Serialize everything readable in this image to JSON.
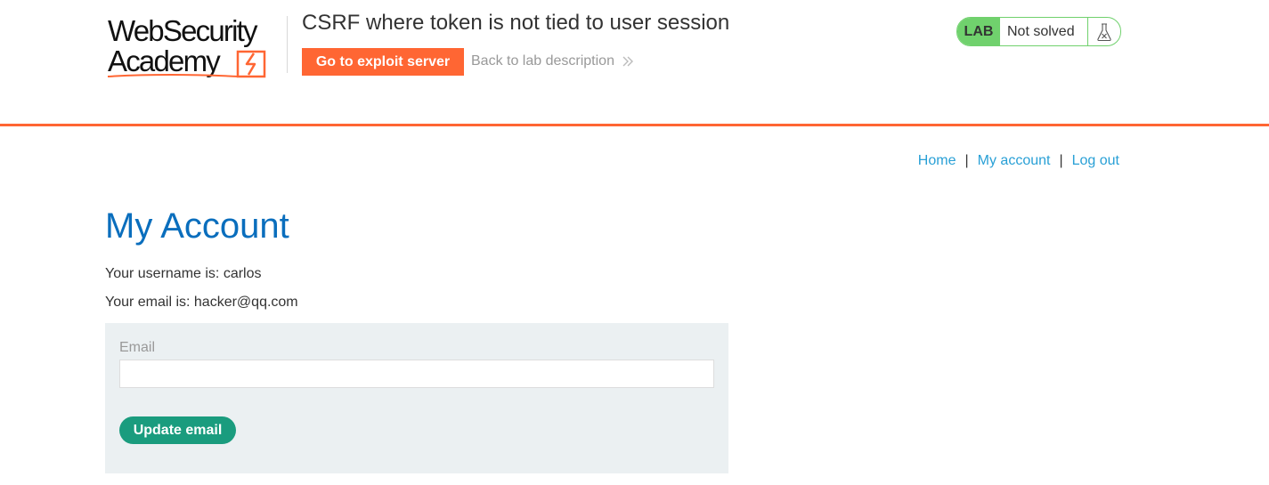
{
  "header": {
    "logo": {
      "line1": "WebSecurity",
      "line2": "Academy",
      "accent_color": "#ff6633"
    },
    "lab_title": "CSRF where token is not tied to user session",
    "exploit_button": "Go to exploit server",
    "back_link": "Back to lab description",
    "status": {
      "tag": "LAB",
      "text": "Not solved",
      "icon": "flask-icon",
      "color": "#70d16d"
    },
    "accent_color": "#ff6633"
  },
  "nav": {
    "items": [
      "Home",
      "My account",
      "Log out"
    ],
    "separator": "|"
  },
  "main": {
    "title": "My Account",
    "username_line": "Your username is: carlos",
    "email_line": "Your email is: hacker@qq.com",
    "form": {
      "email_label": "Email",
      "email_value": "",
      "submit_label": "Update email"
    }
  },
  "colors": {
    "title_blue": "#0a6ebd",
    "link_blue": "#29a0d6",
    "button_green": "#1a9c7e",
    "form_background": "#ebf0f2"
  }
}
